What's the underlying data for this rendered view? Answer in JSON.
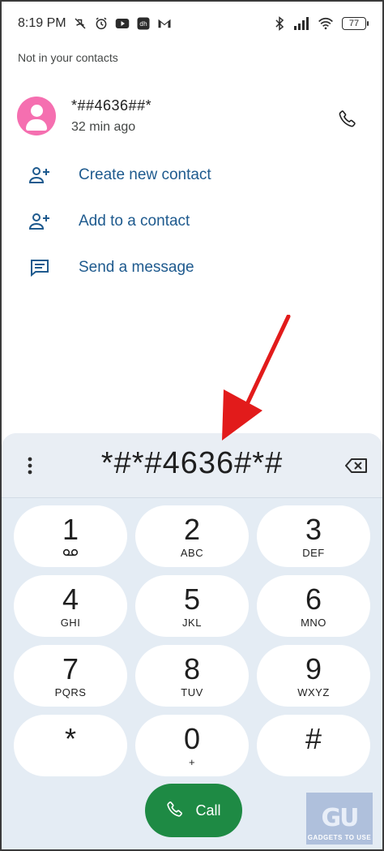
{
  "status_bar": {
    "time": "8:19 PM",
    "left_icons": [
      "missed-call-icon",
      "alarm-icon",
      "youtube-icon",
      "app-icon",
      "gmail-icon"
    ],
    "right_icons": [
      "bluetooth-icon",
      "signal-icon",
      "wifi-icon"
    ],
    "battery": "77"
  },
  "header": {
    "not_in_contacts": "Not in your contacts"
  },
  "recent_call": {
    "number": "*##4636##*",
    "time_ago": "32 min ago",
    "avatar_color": "#f56fb0"
  },
  "actions": [
    {
      "label": "Create new contact",
      "icon": "add-person-icon"
    },
    {
      "label": "Add to a contact",
      "icon": "add-person-icon"
    },
    {
      "label": "Send a message",
      "icon": "message-icon"
    }
  ],
  "dialpad": {
    "entered_digits": "*#*#4636#*#",
    "keys": [
      {
        "digit": "1",
        "letters": ""
      },
      {
        "digit": "2",
        "letters": "ABC"
      },
      {
        "digit": "3",
        "letters": "DEF"
      },
      {
        "digit": "4",
        "letters": "GHI"
      },
      {
        "digit": "5",
        "letters": "JKL"
      },
      {
        "digit": "6",
        "letters": "MNO"
      },
      {
        "digit": "7",
        "letters": "PQRS"
      },
      {
        "digit": "8",
        "letters": "TUV"
      },
      {
        "digit": "9",
        "letters": "WXYZ"
      },
      {
        "digit": "*",
        "letters": ""
      },
      {
        "digit": "0",
        "letters": "+"
      },
      {
        "digit": "#",
        "letters": ""
      }
    ],
    "call_label": "Call"
  },
  "watermark": {
    "logo": "GU",
    "text": "GADGETS TO USE"
  },
  "colors": {
    "accent_blue": "#1e5a8e",
    "call_green": "#1e8a44",
    "arrow_red": "#e21b1b",
    "dialpad_bg": "#e4ecf4"
  }
}
